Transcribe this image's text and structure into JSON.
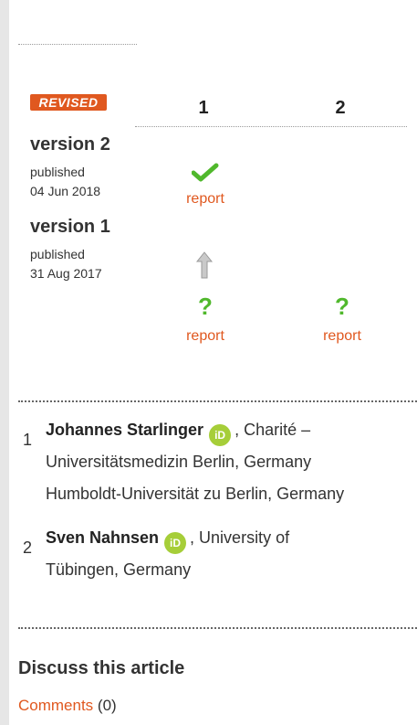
{
  "versions_panel": {
    "revised_badge": "REVISED",
    "columns": [
      "1",
      "2"
    ],
    "versions": [
      {
        "title": "version 2",
        "published_label": "published",
        "date": "04 Jun 2018"
      },
      {
        "title": "version 1",
        "published_label": "published",
        "date": "31 Aug 2017"
      }
    ],
    "report_label": "report",
    "question_mark": "?",
    "status_icons": {
      "v2_reviewer1": "approved-check-icon",
      "v1_reviewer1": "approved-with-reservations-icon",
      "v1_reviewer2": "approved-with-reservations-icon"
    },
    "accent_color": "#e0581f",
    "approve_color": "#50b82c"
  },
  "reviewers": [
    {
      "number": "1",
      "name": "Johannes Starlinger",
      "orcid_label": "iD",
      "affil_line1_suffix": ", Charité –",
      "affil_line2": "Universitätsmedizin Berlin, Germany",
      "affil_line3": "Humboldt-Universität zu Berlin, Germany"
    },
    {
      "number": "2",
      "name": "Sven Nahnsen",
      "orcid_label": "iD",
      "affil_line1_suffix": ", University of",
      "affil_line2": "Tübingen, Germany"
    }
  ],
  "discuss": {
    "title": "Discuss this article",
    "comments_link": "Comments",
    "comments_count": " (0)"
  }
}
